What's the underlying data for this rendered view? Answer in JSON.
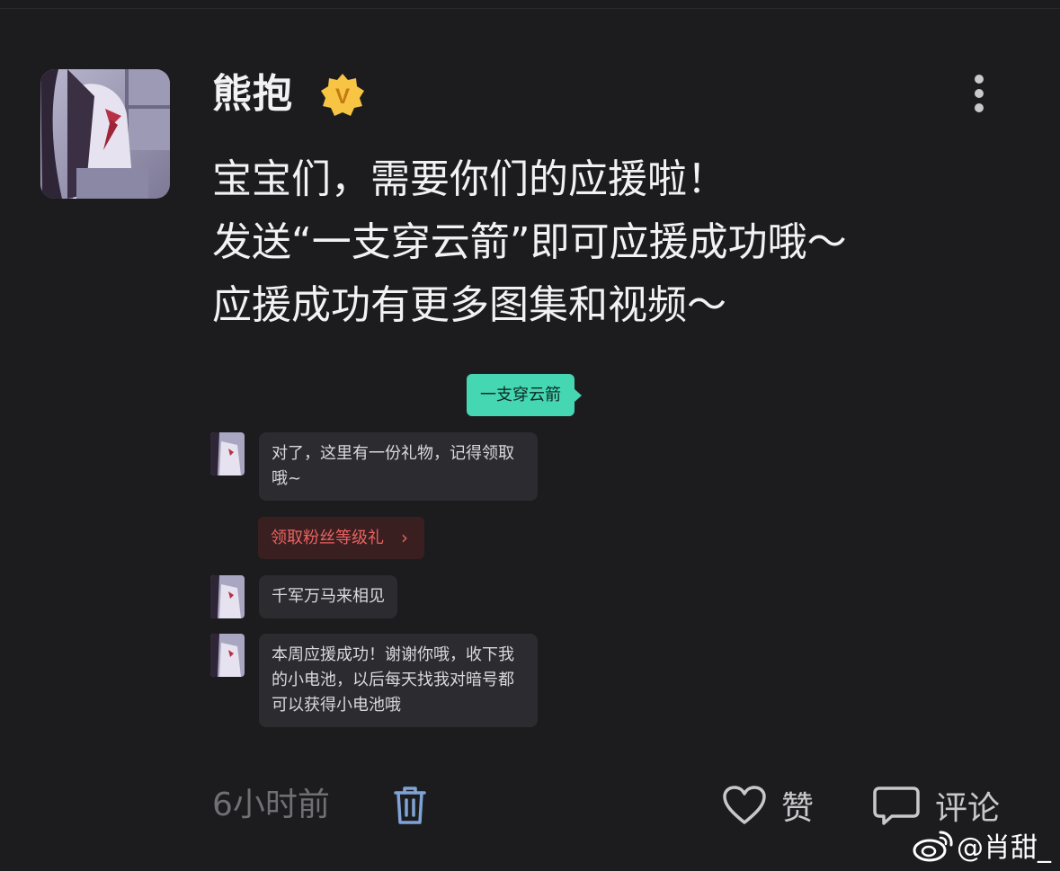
{
  "author": {
    "name": "熊抱",
    "verified_glyph": "V"
  },
  "post": {
    "lines": [
      "宝宝们，需要你们的应援啦！",
      "发送“一支穿云箭”即可应援成功哦～",
      "应援成功有更多图集和视频～"
    ]
  },
  "chat": {
    "sent_message": "一支穿云箭",
    "messages": [
      "对了，这里有一份礼物，记得领取哦~",
      "千军万马来相见",
      "本周应援成功！谢谢你哦，收下我的小电池，以后每天找我对暗号都可以获得小电池哦"
    ],
    "gift_button_label": "领取粉丝等级礼",
    "gift_chevron": "›"
  },
  "footer": {
    "timestamp": "6小时前",
    "like_label": "赞",
    "comment_label": "评论"
  },
  "watermark": {
    "text": "@肖甜_"
  },
  "colors": {
    "background": "#1c1c1f",
    "sent_bubble": "#45d6b2",
    "received_bubble": "#2c2c30",
    "gift_text": "#e8625f",
    "badge": "#f7c444"
  },
  "icons": [
    "more-vertical-icon",
    "verified-badge-icon",
    "trash-icon",
    "heart-icon",
    "comment-icon",
    "weibo-logo-icon"
  ]
}
